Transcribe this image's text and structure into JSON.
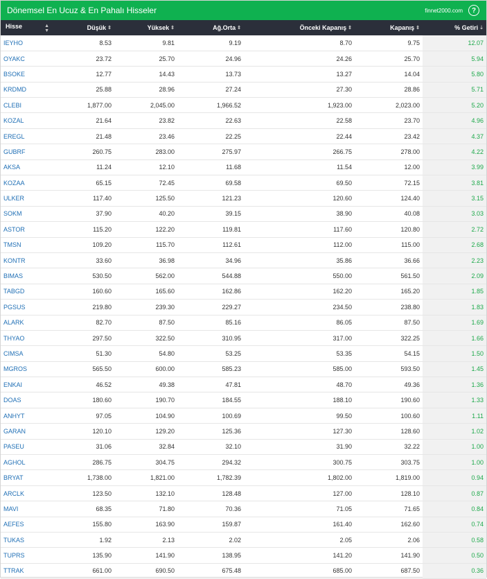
{
  "header": {
    "title": "Dönemsel En Ucuz & En Pahalı Hisseler",
    "brand": "finnet2000.com",
    "help_glyph": "?"
  },
  "colors": {
    "accent": "#0fb150",
    "header_bg": "#2b2f3a",
    "link": "#1f6fb5",
    "positive": "#1ea94b"
  },
  "columns": [
    "Hisse",
    "Düşük",
    "Yüksek",
    "Ağ.Orta",
    "Önceki Kapanış",
    "Kapanış",
    "% Getiri"
  ],
  "rows": [
    [
      "IEYHO",
      "8.53",
      "9.81",
      "9.19",
      "8.70",
      "9.75",
      "12.07"
    ],
    [
      "OYAKC",
      "23.72",
      "25.70",
      "24.96",
      "24.26",
      "25.70",
      "5.94"
    ],
    [
      "BSOKE",
      "12.77",
      "14.43",
      "13.73",
      "13.27",
      "14.04",
      "5.80"
    ],
    [
      "KRDMD",
      "25.88",
      "28.96",
      "27.24",
      "27.30",
      "28.86",
      "5.71"
    ],
    [
      "CLEBI",
      "1,877.00",
      "2,045.00",
      "1,966.52",
      "1,923.00",
      "2,023.00",
      "5.20"
    ],
    [
      "KOZAL",
      "21.64",
      "23.82",
      "22.63",
      "22.58",
      "23.70",
      "4.96"
    ],
    [
      "EREGL",
      "21.48",
      "23.46",
      "22.25",
      "22.44",
      "23.42",
      "4.37"
    ],
    [
      "GUBRF",
      "260.75",
      "283.00",
      "275.97",
      "266.75",
      "278.00",
      "4.22"
    ],
    [
      "AKSA",
      "11.24",
      "12.10",
      "11.68",
      "11.54",
      "12.00",
      "3.99"
    ],
    [
      "KOZAA",
      "65.15",
      "72.45",
      "69.58",
      "69.50",
      "72.15",
      "3.81"
    ],
    [
      "ULKER",
      "117.40",
      "125.50",
      "121.23",
      "120.60",
      "124.40",
      "3.15"
    ],
    [
      "SOKM",
      "37.90",
      "40.20",
      "39.15",
      "38.90",
      "40.08",
      "3.03"
    ],
    [
      "ASTOR",
      "115.20",
      "122.20",
      "119.81",
      "117.60",
      "120.80",
      "2.72"
    ],
    [
      "TMSN",
      "109.20",
      "115.70",
      "112.61",
      "112.00",
      "115.00",
      "2.68"
    ],
    [
      "KONTR",
      "33.60",
      "36.98",
      "34.96",
      "35.86",
      "36.66",
      "2.23"
    ],
    [
      "BIMAS",
      "530.50",
      "562.00",
      "544.88",
      "550.00",
      "561.50",
      "2.09"
    ],
    [
      "TABGD",
      "160.60",
      "165.60",
      "162.86",
      "162.20",
      "165.20",
      "1.85"
    ],
    [
      "PGSUS",
      "219.80",
      "239.30",
      "229.27",
      "234.50",
      "238.80",
      "1.83"
    ],
    [
      "ALARK",
      "82.70",
      "87.50",
      "85.16",
      "86.05",
      "87.50",
      "1.69"
    ],
    [
      "THYAO",
      "297.50",
      "322.50",
      "310.95",
      "317.00",
      "322.25",
      "1.66"
    ],
    [
      "CIMSA",
      "51.30",
      "54.80",
      "53.25",
      "53.35",
      "54.15",
      "1.50"
    ],
    [
      "MGROS",
      "565.50",
      "600.00",
      "585.23",
      "585.00",
      "593.50",
      "1.45"
    ],
    [
      "ENKAI",
      "46.52",
      "49.38",
      "47.81",
      "48.70",
      "49.36",
      "1.36"
    ],
    [
      "DOAS",
      "180.60",
      "190.70",
      "184.55",
      "188.10",
      "190.60",
      "1.33"
    ],
    [
      "ANHYT",
      "97.05",
      "104.90",
      "100.69",
      "99.50",
      "100.60",
      "1.11"
    ],
    [
      "GARAN",
      "120.10",
      "129.20",
      "125.36",
      "127.30",
      "128.60",
      "1.02"
    ],
    [
      "PASEU",
      "31.06",
      "32.84",
      "32.10",
      "31.90",
      "32.22",
      "1.00"
    ],
    [
      "AGHOL",
      "286.75",
      "304.75",
      "294.32",
      "300.75",
      "303.75",
      "1.00"
    ],
    [
      "BRYAT",
      "1,738.00",
      "1,821.00",
      "1,782.39",
      "1,802.00",
      "1,819.00",
      "0.94"
    ],
    [
      "ARCLK",
      "123.50",
      "132.10",
      "128.48",
      "127.00",
      "128.10",
      "0.87"
    ],
    [
      "MAVI",
      "68.35",
      "71.80",
      "70.36",
      "71.05",
      "71.65",
      "0.84"
    ],
    [
      "AEFES",
      "155.80",
      "163.90",
      "159.87",
      "161.40",
      "162.60",
      "0.74"
    ],
    [
      "TUKAS",
      "1.92",
      "2.13",
      "2.02",
      "2.05",
      "2.06",
      "0.58"
    ],
    [
      "TUPRS",
      "135.90",
      "141.90",
      "138.95",
      "141.20",
      "141.90",
      "0.50"
    ],
    [
      "TTRAK",
      "661.00",
      "690.50",
      "675.48",
      "685.00",
      "687.50",
      "0.36"
    ]
  ]
}
